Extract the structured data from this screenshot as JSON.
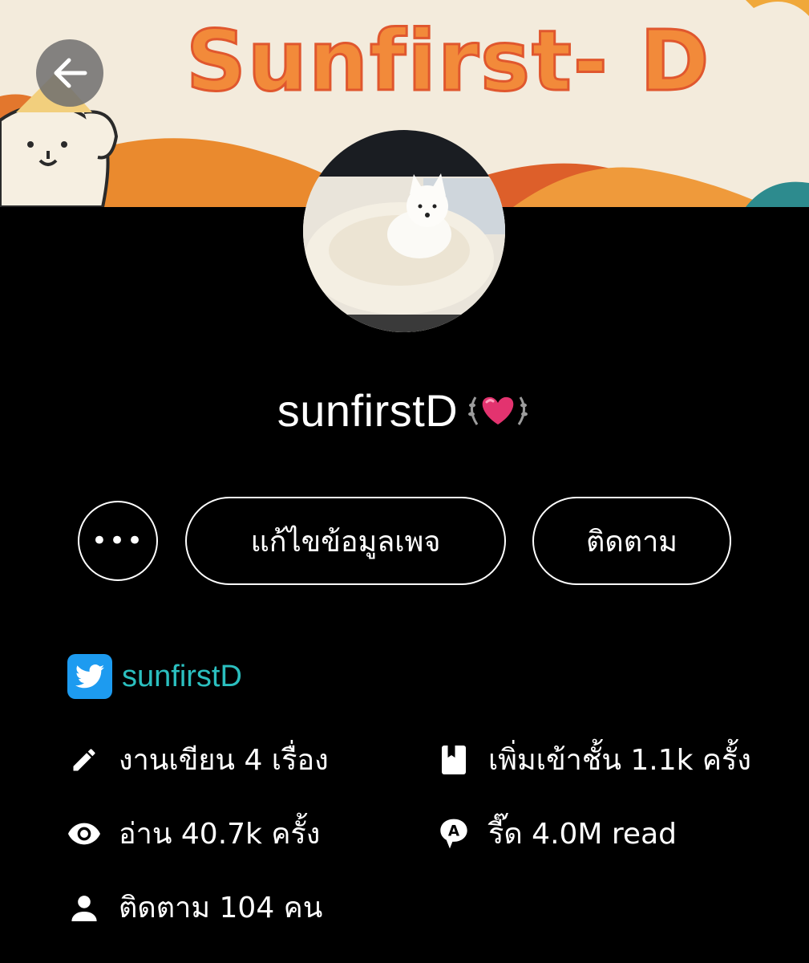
{
  "cover": {
    "title": "Sunfirst- D"
  },
  "header": {
    "back_icon": "arrow-left-icon"
  },
  "profile": {
    "username": "sunfirstD",
    "badge_icon": "heart-laurel-badge-icon"
  },
  "actions": {
    "more_label": "•••",
    "edit_label": "แก้ไขข้อมูลเพจ",
    "follow_label": "ติดตาม"
  },
  "social": {
    "twitter_handle": "sunfirstD",
    "twitter_icon": "twitter-icon"
  },
  "stats": {
    "works": "งานเขียน 4 เรื่อง",
    "shelf": "เพิ่มเข้าชั้น 1.1k ครั้ง",
    "reads": "อ่าน 40.7k ครั้ง",
    "chat_reads": "รี๊ด 4.0M read",
    "followers": "ติดตาม 104 คน"
  },
  "colors": {
    "background": "#000000",
    "twitter_blue": "#1d9bf0",
    "twitter_handle": "#2bbfbf",
    "heart": "#e3336f"
  }
}
